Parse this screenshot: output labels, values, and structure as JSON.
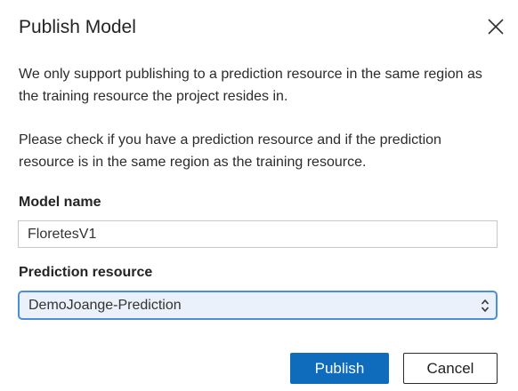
{
  "dialog": {
    "title": "Publish Model",
    "close_icon": "close-icon",
    "paragraph1": "We only support publishing to a prediction resource in the same region as the training resource the project resides in.",
    "paragraph2": "Please check if you have a prediction resource and if the prediction resource is in the same region as the training resource."
  },
  "form": {
    "model_name_label": "Model name",
    "model_name_value": "FloretesV1",
    "prediction_resource_label": "Prediction resource",
    "prediction_resource_value": "DemoJoange-Prediction",
    "select_arrow_icon": "updown-chevron-icon"
  },
  "buttons": {
    "publish_label": "Publish",
    "cancel_label": "Cancel"
  },
  "colors": {
    "primary": "#0f6cbd",
    "select_focus_border": "#4a8fd8",
    "select_background": "#eaf1fb"
  }
}
